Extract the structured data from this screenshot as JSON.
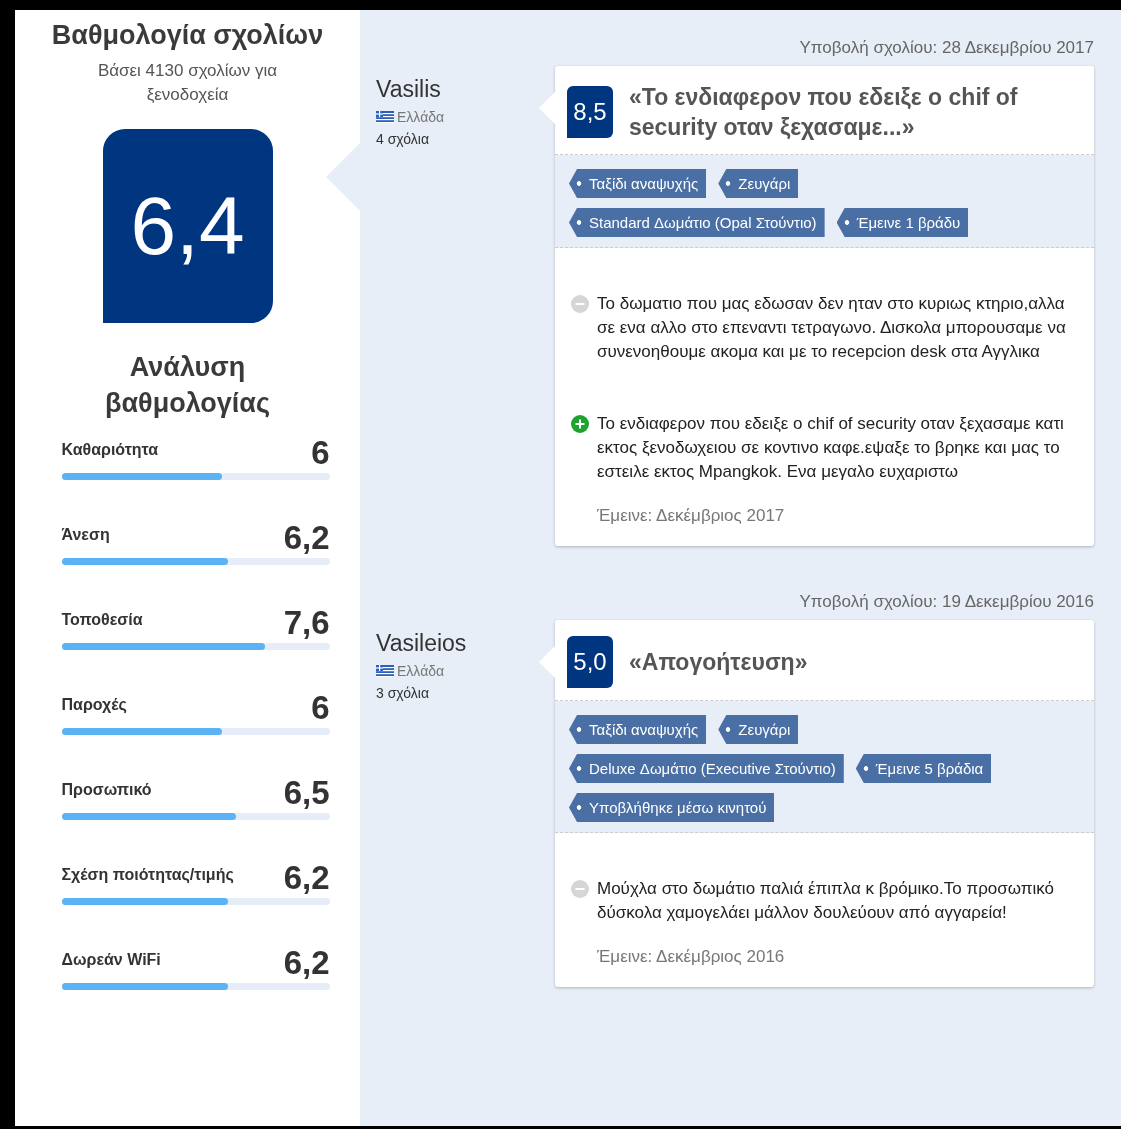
{
  "summary": {
    "title": "Βαθμολογία σχολίων",
    "subtitle": "Βάσει 4130 σχολίων για ξενοδοχεία",
    "score": "6,4",
    "breakdown_title": "Ανάλυση βαθμολογίας",
    "categories": [
      {
        "label": "Καθαριότητα",
        "score": "6",
        "level": 0.6
      },
      {
        "label": "Άνεση",
        "score": "6,2",
        "level": 0.62
      },
      {
        "label": "Τοποθεσία",
        "score": "7,6",
        "level": 0.76
      },
      {
        "label": "Παροχές",
        "score": "6",
        "level": 0.6
      },
      {
        "label": "Προσωπικό",
        "score": "6,5",
        "level": 0.65
      },
      {
        "label": "Σχέση ποιότητας/τιμής",
        "score": "6,2",
        "level": 0.62
      },
      {
        "label": "Δωρεάν WiFi",
        "score": "6,2",
        "level": 0.62
      }
    ]
  },
  "reviews": [
    {
      "submitted": "Υποβολή σχολίου: 28 Δεκεμβρίου 2017",
      "reviewer": {
        "name": "Vasilis",
        "country": "Ελλάδα",
        "review_count": "4 σχόλια"
      },
      "score": "8,5",
      "title": "«Το ενδιαφερον που εδειξε ο chif of security οταν ξεχασαμε...»",
      "tags": [
        "Ταξίδι αναψυχής",
        "Ζευγάρι",
        "Standard Δωμάτιο (Opal Στούντιο)",
        "Έμεινε 1 βράδυ"
      ],
      "comments": [
        {
          "kind": "negative",
          "text": "Το δωματιο που μας εδωσαν  δεν ηταν στο κυριως κτηριο,αλλα σε ενα αλλο στο επεναντι τετραγωνο. Δισκολα μπορουσαμε να συνενοηθουμε ακομα και με το recepcion desk στα Αγγλικα"
        },
        {
          "kind": "positive",
          "text": "Το ενδιαφερον που εδειξε ο chif of security οταν ξεχασαμε κατι εκτος ξενοδωχειου σε κοντινο καφε.εψαξε το βρηκε και μας το εστειλε εκτος Mpangkok. Ενα μεγαλο ευχαριστω"
        }
      ],
      "stayed": "Έμεινε: Δεκέμβριος 2017"
    },
    {
      "submitted": "Υποβολή σχολίου: 19 Δεκεμβρίου 2016",
      "reviewer": {
        "name": "Vasileios",
        "country": "Ελλάδα",
        "review_count": "3 σχόλια"
      },
      "score": "5,0",
      "title": "«Απογοήτευση»",
      "tags": [
        "Ταξίδι αναψυχής",
        "Ζευγάρι",
        "Deluxe Δωμάτιο (Executive Στούντιο)",
        "Έμεινε 5 βράδια",
        "Υποβλήθηκε μέσω κινητού"
      ],
      "comments": [
        {
          "kind": "negative",
          "text": "Μούχλα στο δωμάτιο παλιά έπιπλα κ βρόμικο.Το προσωπικό δύσκολα χαμογελάει μάλλον δουλεύουν από αγγαρεία!"
        }
      ],
      "stayed": "Έμεινε: Δεκέμβριος 2016"
    }
  ]
}
